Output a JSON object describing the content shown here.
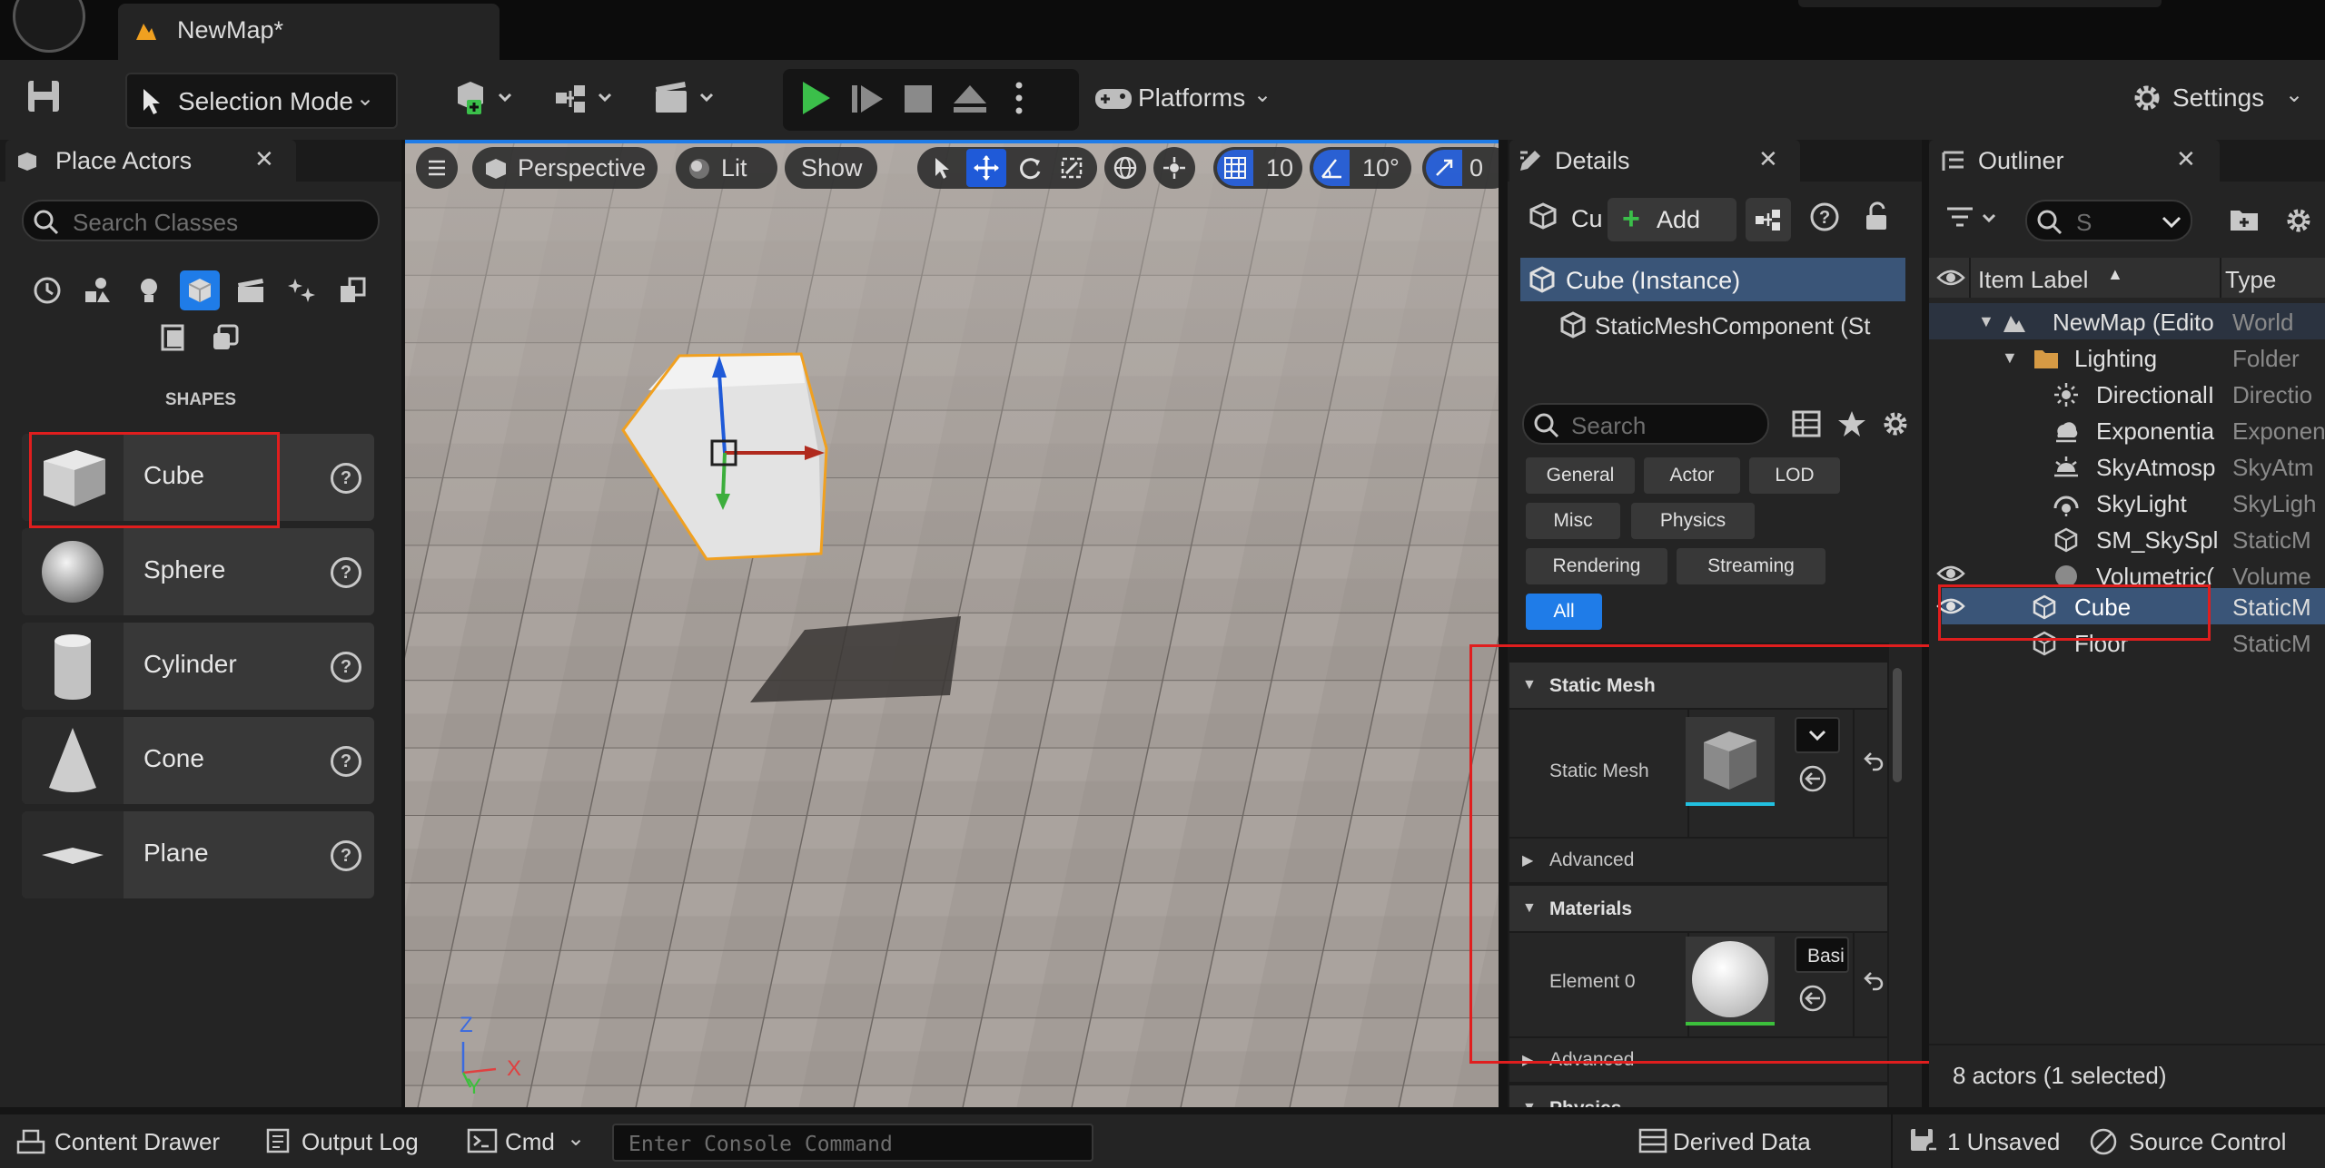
{
  "window": {
    "tab_title": "NewMap*"
  },
  "toolbar": {
    "selection_mode": "Selection Mode",
    "platforms": "Platforms",
    "settings": "Settings",
    "play_color": "#3bbf4a"
  },
  "place_actors": {
    "tab": "Place Actors",
    "search_placeholder": "Search Classes",
    "category_label": "SHAPES",
    "shapes": [
      {
        "label": "Cube",
        "icon": "cube-icon",
        "highlighted": true
      },
      {
        "label": "Sphere",
        "icon": "sphere-icon"
      },
      {
        "label": "Cylinder",
        "icon": "cylinder-icon"
      },
      {
        "label": "Cone",
        "icon": "cone-icon"
      },
      {
        "label": "Plane",
        "icon": "plane-icon"
      }
    ]
  },
  "viewport": {
    "perspective": "Perspective",
    "lit": "Lit",
    "show": "Show",
    "grid_snap": "10",
    "rotation_snap": "10°",
    "scale_snap": "0",
    "axis": {
      "z": "Z",
      "x": "X",
      "y": "Y"
    }
  },
  "details": {
    "tab": "Details",
    "actor_short": "Cu",
    "add": "Add",
    "components": [
      "Cube (Instance)",
      "StaticMeshComponent (St"
    ],
    "search_placeholder": "Search",
    "filters": [
      "General",
      "Actor",
      "LOD",
      "Misc",
      "Physics",
      "Rendering",
      "Streaming",
      "All"
    ],
    "sections": {
      "static_mesh": "Static Mesh",
      "static_mesh_prop": "Static Mesh",
      "advanced1": "Advanced",
      "materials": "Materials",
      "element0": "Element 0",
      "material_value": "Basi",
      "advanced2": "Advanced",
      "physics": "Physics"
    }
  },
  "outliner": {
    "tab": "Outliner",
    "search_placeholder": "S",
    "col_label": "Item Label",
    "col_type": "Type",
    "rows": [
      {
        "label": "NewMap (Edito",
        "type": "World"
      },
      {
        "label": "Lighting",
        "type": "Folder"
      },
      {
        "label": "DirectionalI",
        "type": "Directio"
      },
      {
        "label": "Exponentia",
        "type": "Exponen"
      },
      {
        "label": "SkyAtmosp",
        "type": "SkyAtm"
      },
      {
        "label": "SkyLight",
        "type": "SkyLigh"
      },
      {
        "label": "SM_SkySpl",
        "type": "StaticM"
      },
      {
        "label": "Volumetric(",
        "type": "Volume"
      },
      {
        "label": "Cube",
        "type": "StaticM"
      },
      {
        "label": "Floor",
        "type": "StaticM"
      }
    ],
    "footer": "8 actors (1 selected)"
  },
  "statusbar": {
    "content_drawer": "Content Drawer",
    "output_log": "Output Log",
    "cmd": "Cmd",
    "console_placeholder": "Enter Console Command",
    "derived_data": "Derived Data",
    "unsaved": "1 Unsaved",
    "source_control": "Source Control"
  }
}
